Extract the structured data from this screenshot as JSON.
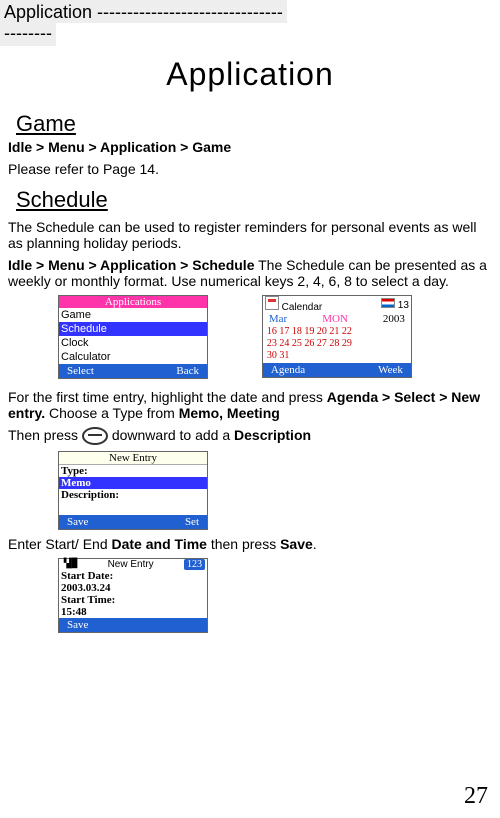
{
  "header": {
    "line1": "Application -------------------------------",
    "line2": "--------"
  },
  "title": "Application",
  "sections": {
    "game": {
      "heading": "Game",
      "breadcrumb": "Idle > Menu > Application > Game",
      "text": "Please refer to Page 14."
    },
    "schedule": {
      "heading": "Schedule",
      "intro": "The Schedule can be used to register reminders for personal events as well as planning holiday periods.",
      "breadcrumb": "Idle > Menu > Application > Schedule",
      "desc": " The Schedule can be presented as a weekly or monthly format. Use numerical keys 2, 4, 6, 8 to select a day.",
      "first_pre": "For the first time entry, highlight the date and press ",
      "first_bold": "Agenda > Select > New entry.",
      "first_mid": " Choose a Type from ",
      "first_bold2": "Memo, Meeting",
      "then_pre": "Then press ",
      "then_post": " downward to add a ",
      "then_bold": "Description",
      "save_pre": "Enter Start/ End ",
      "save_bold1": "Date and Time",
      "save_mid": " then press ",
      "save_bold2": "Save",
      "save_post": "."
    }
  },
  "fig_apps": {
    "title": "Applications",
    "items": [
      "Game",
      "Schedule",
      "Clock",
      "Calculator"
    ],
    "selected_index": 1,
    "soft_left": "Select",
    "soft_right": "Back"
  },
  "fig_cal": {
    "status_label": "Calendar",
    "status_week": "13",
    "month": "Mar",
    "day": "MON",
    "year": "2003",
    "row1": "16 17 18 19 20 21 22",
    "row2": "23 24 25 26 27 28 29",
    "row3": "30 31",
    "soft_left": "Agenda",
    "soft_right": "Week"
  },
  "fig_new1": {
    "title": "New Entry",
    "r1": "Type:",
    "r2": "Memo",
    "r3": "Description:",
    "soft_left": "Save",
    "soft_right": "Set"
  },
  "fig_new2": {
    "title": "New Entry",
    "sig": "123",
    "r1": "Start Date:",
    "r2": "2003.03.24",
    "r3": "Start Time:",
    "r4": "15:48",
    "soft_left": "Save"
  },
  "page_number": "27"
}
